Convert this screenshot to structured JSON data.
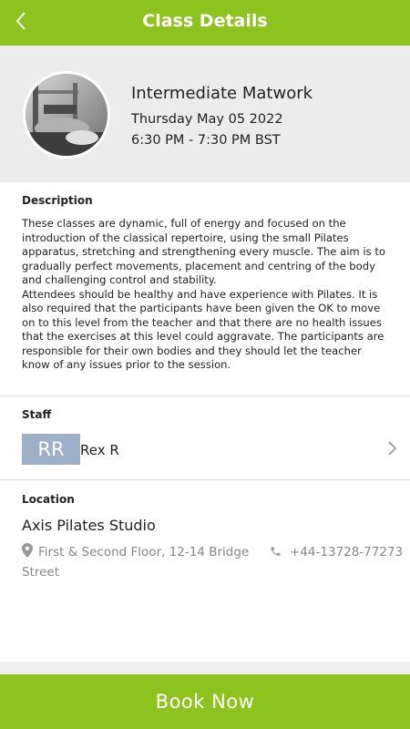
{
  "header": {
    "title": "Class Details",
    "back_icon": "chevron-left-icon"
  },
  "class_info": {
    "name": "Intermediate Matwork",
    "date": "Thursday May 05 2022",
    "time": "6:30 PM - 7:30 PM BST"
  },
  "description": {
    "label": "Description",
    "paragraph1": "These classes are dynamic, full of energy and focused on the introduction of the classical repertoire, using the small Pilates apparatus, stretching and strengthening every muscle. The aim is to gradually perfect movements, placement and centring of the body and challenging control and stability.",
    "paragraph2": "Attendees should be healthy and have experience with Pilates. It is also required that the participants have been given the OK to move on to this level from the teacher and that there are no health issues that the exercises at this level could aggravate. The participants are responsible for their own bodies and they should let the teacher know of any issues prior to the session."
  },
  "staff": {
    "label": "Staff",
    "initials": "RR",
    "name": "Rex R"
  },
  "location": {
    "label": "Location",
    "name": "Axis Pilates Studio",
    "address": "First & Second Floor, 12-14 Bridge Street",
    "phone": "+44-13728-77273"
  },
  "book_button": {
    "label": "Book Now"
  },
  "colors": {
    "accent": "#8dc21f",
    "hero_bg": "#ececec",
    "initials_bg": "#9eafc8"
  }
}
